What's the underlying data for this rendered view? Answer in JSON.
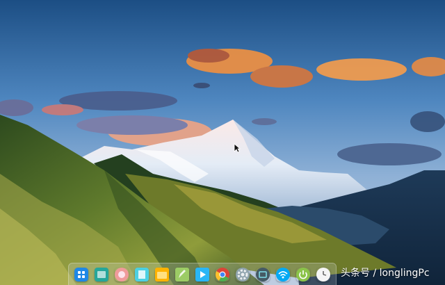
{
  "desktop": {
    "wallpaper": "snow-mountain-landscape"
  },
  "dock": {
    "items": [
      {
        "name": "launcher-icon",
        "color": "#1e88e5"
      },
      {
        "name": "deepin-store-icon",
        "color": "#26a69a"
      },
      {
        "name": "music-icon",
        "color": "#ef9a9a"
      },
      {
        "name": "deepin-files-icon",
        "color": "#4dd0e1"
      },
      {
        "name": "file-manager-icon",
        "color": "#ffb300"
      },
      {
        "name": "text-editor-icon",
        "color": "#9ccc65"
      },
      {
        "name": "video-player-icon",
        "color": "#29b6f6"
      },
      {
        "name": "chrome-icon",
        "color": "#4caf50"
      },
      {
        "name": "settings-icon",
        "color": "#90a4ae"
      },
      {
        "name": "screen-capture-icon",
        "color": "#455a64"
      },
      {
        "name": "network-icon",
        "color": "#03a9f4"
      },
      {
        "name": "power-icon",
        "color": "#8bc34a"
      },
      {
        "name": "clock-icon",
        "color": "#f5f5f5"
      }
    ]
  },
  "watermark": {
    "text": "头条号 / longlingPc"
  }
}
